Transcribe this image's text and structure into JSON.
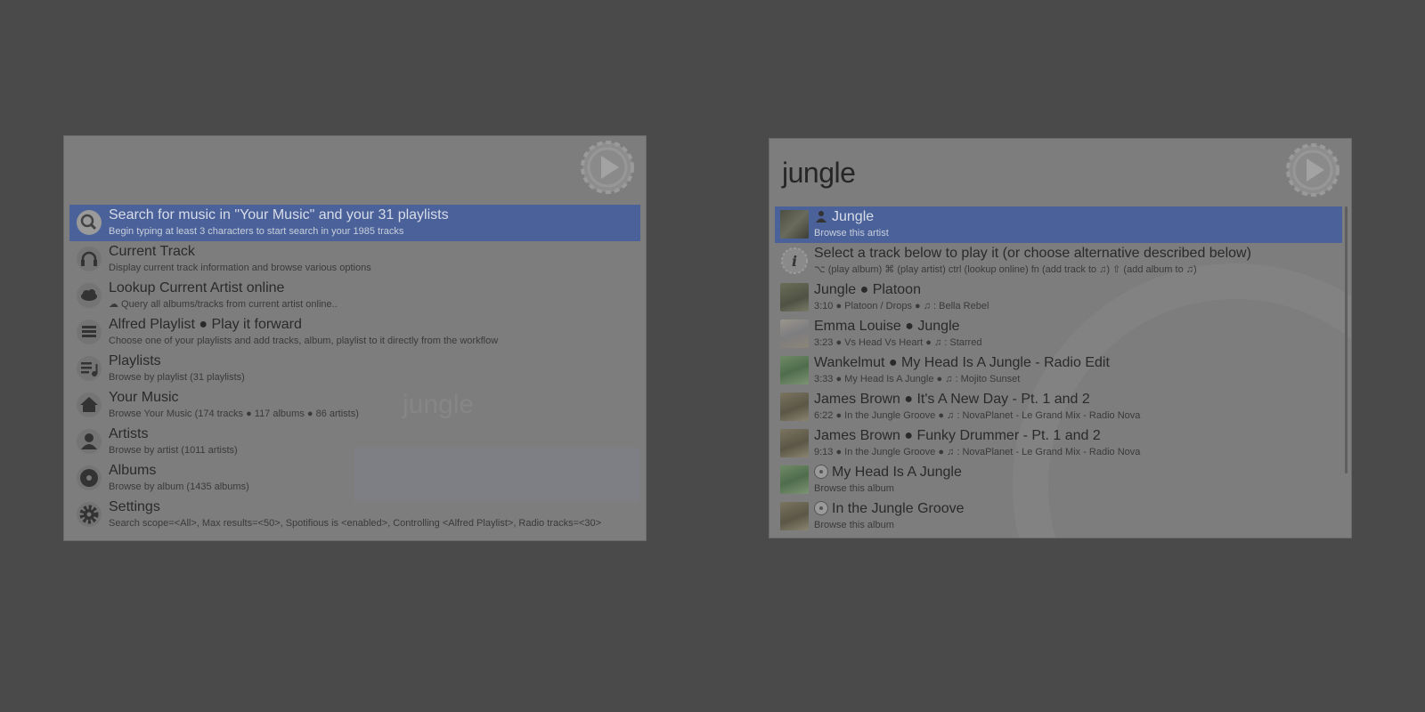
{
  "left_panel": {
    "query": "",
    "ghost_text": "jungle",
    "items": [
      {
        "icon": "search-icon",
        "title": "Search for music in \"Your Music\" and your 31 playlists",
        "subtitle": "Begin typing at least 3 characters to start search in your 1985 tracks"
      },
      {
        "icon": "headphones-icon",
        "title": "Current Track",
        "subtitle": "Display current track information and browse various options"
      },
      {
        "icon": "cloud-icon",
        "title": "Lookup Current Artist online",
        "subtitle": "☁ Query all albums/tracks from current artist online.."
      },
      {
        "icon": "playlist-icon",
        "title": "Alfred Playlist ● Play it forward",
        "subtitle": "Choose one of your playlists and add tracks, album, playlist to it directly from the workflow"
      },
      {
        "icon": "playlists-icon",
        "title": "Playlists",
        "subtitle": "Browse by playlist (31 playlists)"
      },
      {
        "icon": "home-icon",
        "title": "Your Music",
        "subtitle": "Browse Your Music (174 tracks ● 117  albums ● 86 artists)"
      },
      {
        "icon": "artist-icon",
        "title": "Artists",
        "subtitle": "Browse by artist (1011 artists)"
      },
      {
        "icon": "album-icon",
        "title": "Albums",
        "subtitle": "Browse by album (1435 albums)"
      },
      {
        "icon": "gear-icon",
        "title": "Settings",
        "subtitle": "Search scope=<All>, Max results=<50>, Spotifious is <enabled>, Controlling <Alfred Playlist>, Radio tracks=<30>"
      }
    ]
  },
  "right_panel": {
    "query": "jungle",
    "items": [
      {
        "thumb": "#5a5a4a",
        "inline_icon": "artist",
        "title": "Jungle",
        "subtitle": "Browse this artist"
      },
      {
        "icon": "info-icon",
        "title": "Select a track below to play it (or choose alternative described below)",
        "subtitle": "⌥ (play album) ⌘ (play artist) ctrl (lookup online) fn (add track to ♫) ⇧ (add album to ♫)"
      },
      {
        "thumb": "#5e6350",
        "title": "Jungle ● Platoon",
        "subtitle": "3:10 ● Platoon / Drops ● ♫ : Bella Rebel"
      },
      {
        "thumb": "#8a8a82",
        "title": "Emma Louise ● Jungle",
        "subtitle": "3:23 ● Vs Head Vs Heart ● ♫ : Starred"
      },
      {
        "thumb": "#5d7a5a",
        "title": "Wankelmut ● My Head Is A Jungle - Radio Edit",
        "subtitle": "3:33 ● My Head Is A Jungle ● ♫ : Mojito Sunset"
      },
      {
        "thumb": "#6e6a58",
        "title": "James Brown ● It's A New Day - Pt. 1 and 2",
        "subtitle": "6:22 ● In the Jungle Groove ● ♫ : NovaPlanet - Le Grand Mix - Radio Nova"
      },
      {
        "thumb": "#6e6a58",
        "title": "James Brown ● Funky Drummer - Pt. 1 and 2",
        "subtitle": "9:13 ● In the Jungle Groove ● ♫ : NovaPlanet - Le Grand Mix - Radio Nova"
      },
      {
        "thumb": "#5d7a5a",
        "inline_icon": "album",
        "title": "My Head Is A Jungle",
        "subtitle": "Browse this album"
      },
      {
        "thumb": "#6e6a58",
        "inline_icon": "album",
        "title": "In the Jungle Groove",
        "subtitle": "Browse this album"
      }
    ]
  }
}
